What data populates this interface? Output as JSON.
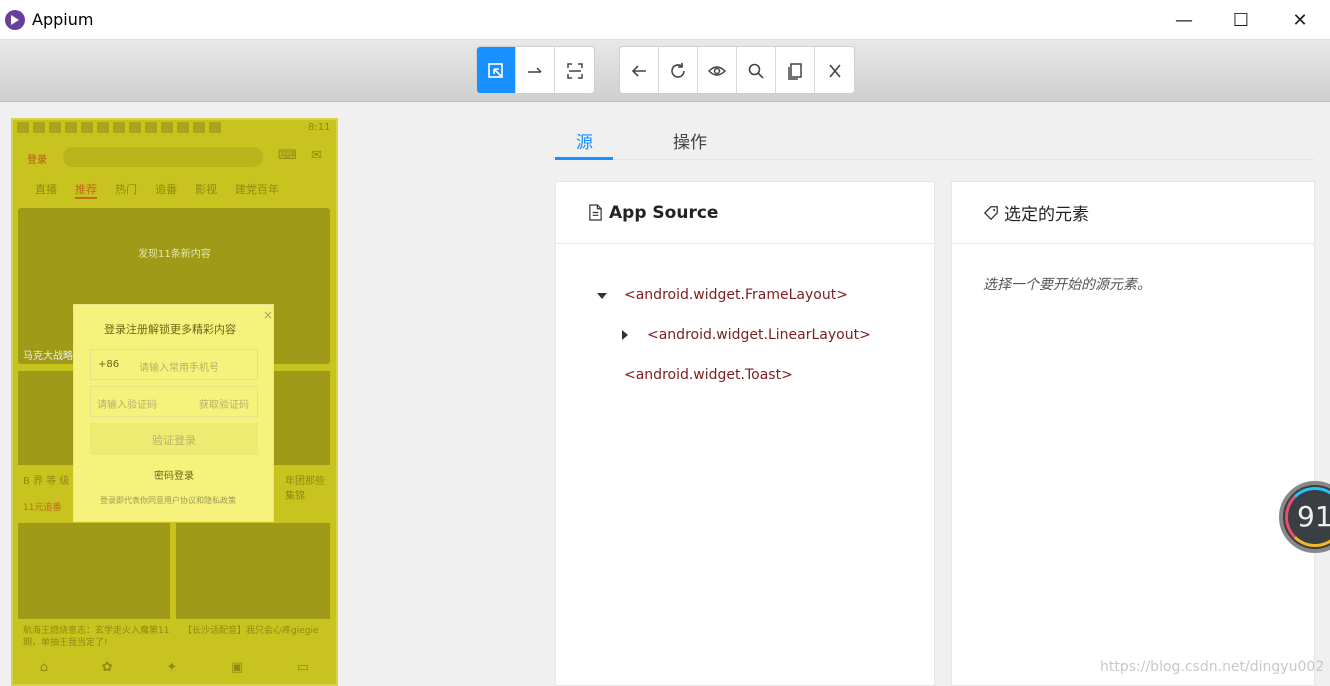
{
  "window": {
    "title": "Appium",
    "minimize": "—",
    "maximize": "☐",
    "close": "✕"
  },
  "toolbar": {
    "group1": [
      "select-element-icon",
      "swipe-icon",
      "tap-coordinates-icon"
    ],
    "group2": [
      "back-icon",
      "refresh-icon",
      "show-icon",
      "search-icon",
      "copy-xml-icon",
      "quit-icon"
    ]
  },
  "phone": {
    "time": "8:11",
    "login_link": "登录",
    "nav_tabs": [
      "直播",
      "推荐",
      "热门",
      "追番",
      "影视",
      "建党百年"
    ],
    "banner_notice": "发现11条新内容",
    "banner_title": "马克大战略",
    "card1_text": "B 界 等 级 向",
    "card1_sub": "11元追番",
    "card2_text": "年团那些集锦",
    "card3_title": "航海王燃烧意志：玄学走火入魔第11期，单抽王我当定了!",
    "card4_title": "【长沙话配音】我只会心疼giegie",
    "dialog": {
      "title": "登录注册解锁更多精彩内容",
      "country_code": "+86",
      "phone_placeholder": "请输入常用手机号",
      "code_placeholder": "请输入验证码",
      "get_code": "获取验证码",
      "verify_login": "验证登录",
      "password_login": "密码登录",
      "agreement": "登录即代表你同意用户协议和隐私政策",
      "close": "×"
    }
  },
  "tabs": {
    "source": "源",
    "actions": "操作"
  },
  "app_source": {
    "title": "App Source",
    "nodes": [
      {
        "label": "<android.widget.FrameLayout>",
        "expanded": true
      },
      {
        "label": "<android.widget.LinearLayout>",
        "expanded": false
      },
      {
        "label": "<android.widget.Toast>",
        "expanded": null
      }
    ]
  },
  "selected_element": {
    "title": "选定的元素",
    "hint": "选择一个要开始的源元素。"
  },
  "gauge": {
    "value": "91"
  },
  "watermark": "https://blog.csdn.net/dingyu002"
}
